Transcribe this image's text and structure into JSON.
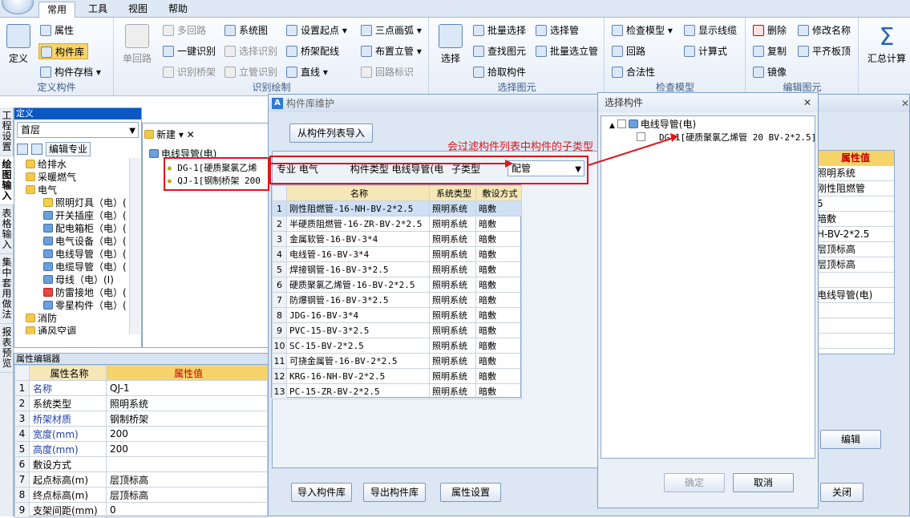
{
  "ribbon": {
    "tabs": [
      "常用",
      "工具",
      "视图",
      "帮助"
    ],
    "active_tab": "常用",
    "groups": {
      "define": {
        "label": "定义构件",
        "big_button": "定义",
        "items": [
          "属性",
          "构件库",
          "构件存档"
        ]
      },
      "draw": {
        "label": "识别绘制",
        "big_button": "单回路",
        "items": [
          "多回路",
          "一键识别",
          "识别桥架",
          "系统图",
          "选择识别",
          "立管识别",
          "设置起点",
          "桥架配线",
          "直线",
          "三点画弧",
          "布置立管",
          "回路标识"
        ]
      },
      "select": {
        "label": "选择图元",
        "big_button": "选择",
        "items": [
          "批量选择",
          "查找图元",
          "拾取构件",
          "选择管",
          "批量选立管"
        ]
      },
      "check": {
        "label": "检查模型",
        "items": [
          "检查模型",
          "回路",
          "合法性",
          "显示线缆",
          "计算式"
        ]
      },
      "edit": {
        "label": "编辑图元",
        "items": [
          "删除",
          "复制",
          "镜像",
          "修改名称",
          "平齐板顶"
        ]
      },
      "calc": {
        "big_button": "汇总计算"
      }
    }
  },
  "left_nav": {
    "tabs": [
      "工程设置",
      "绘图输入",
      "表格输入",
      "集中套用做法",
      "报表预览"
    ],
    "active": "绘图输入"
  },
  "define_panel": {
    "title": "定义",
    "floor": "首层",
    "edit_label": "编辑专业",
    "tree": [
      {
        "label": "给排水",
        "level": 1,
        "type": "folder"
      },
      {
        "label": "采暖燃气",
        "level": 1,
        "type": "folder"
      },
      {
        "label": "电气",
        "level": 1,
        "type": "folder"
      },
      {
        "label": "照明灯具（电）(",
        "level": 2,
        "type": "item"
      },
      {
        "label": "开关插座（电）(",
        "level": 2,
        "type": "item"
      },
      {
        "label": "配电箱柜（电）(",
        "level": 2,
        "type": "item"
      },
      {
        "label": "电气设备（电）(",
        "level": 2,
        "type": "item"
      },
      {
        "label": "电线导管（电）(",
        "level": 2,
        "type": "item"
      },
      {
        "label": "电缆导管（电）(",
        "level": 2,
        "type": "item"
      },
      {
        "label": "母线（电）(I)",
        "level": 2,
        "type": "item"
      },
      {
        "label": "防雷接地（电）(",
        "level": 2,
        "type": "item"
      },
      {
        "label": "零星构件（电）(",
        "level": 2,
        "type": "item"
      },
      {
        "label": "消防",
        "level": 1,
        "type": "folder"
      },
      {
        "label": "通风空调",
        "level": 1,
        "type": "folder"
      }
    ]
  },
  "component_list": {
    "new_label": "新建",
    "root": "电线导管(电)",
    "items": [
      "DG-1[硬质聚氯乙烯",
      "QJ-1[钢制桥架 200"
    ]
  },
  "property_editor": {
    "title": "属性编辑器",
    "col_name": "属性名称",
    "col_value": "属性值",
    "rows": [
      {
        "n": "1",
        "name": "名称",
        "value": "QJ-1"
      },
      {
        "n": "2",
        "name": "系统类型",
        "value": "照明系统"
      },
      {
        "n": "3",
        "name": "桥架材质",
        "value": "钢制桥架"
      },
      {
        "n": "4",
        "name": "宽度(mm)",
        "value": "200"
      },
      {
        "n": "5",
        "name": "高度(mm)",
        "value": "200"
      },
      {
        "n": "6",
        "name": "敷设方式",
        "value": ""
      },
      {
        "n": "7",
        "name": "起点标高(m)",
        "value": "层顶标高"
      },
      {
        "n": "8",
        "name": "终点标高(m)",
        "value": "层顶标高"
      },
      {
        "n": "9",
        "name": "支架间距(mm)",
        "value": "0"
      }
    ]
  },
  "library_dialog": {
    "title": "构件库维护",
    "import_from_list": "从构件列表导入",
    "filter": {
      "specialty_label": "专业",
      "specialty_value": "电气",
      "type_label": "构件类型",
      "type_value": "电线导管(电",
      "subtype_label": "子类型",
      "subtype_value": "配管"
    },
    "grid_headers": [
      "名称",
      "系统类型",
      "敷设方式"
    ],
    "rows": [
      {
        "n": "1",
        "name": "刚性阻燃管-16-NH-BV-2*2.5",
        "system": "照明系统",
        "lay": "暗敷"
      },
      {
        "n": "2",
        "name": "半硬质阻燃管-16-ZR-BV-2*2.5",
        "system": "照明系统",
        "lay": "暗敷"
      },
      {
        "n": "3",
        "name": "金属软管-16-BV-3*4",
        "system": "照明系统",
        "lay": "暗敷"
      },
      {
        "n": "4",
        "name": "电线管-16-BV-3*4",
        "system": "照明系统",
        "lay": "暗敷"
      },
      {
        "n": "5",
        "name": "焊接钢管-16-BV-3*2.5",
        "system": "照明系统",
        "lay": "暗敷"
      },
      {
        "n": "6",
        "name": "硬质聚氯乙烯管-16-BV-2*2.5",
        "system": "照明系统",
        "lay": "暗敷"
      },
      {
        "n": "7",
        "name": "防爆钢管-16-BV-3*2.5",
        "system": "照明系统",
        "lay": "暗敷"
      },
      {
        "n": "8",
        "name": "JDG-16-BV-3*4",
        "system": "照明系统",
        "lay": "暗敷"
      },
      {
        "n": "9",
        "name": "PVC-15-BV-3*2.5",
        "system": "照明系统",
        "lay": "暗敷"
      },
      {
        "n": "10",
        "name": "SC-15-BV-2*2.5",
        "system": "照明系统",
        "lay": "暗敷"
      },
      {
        "n": "11",
        "name": "可挠金属管-16-BV-2*2.5",
        "system": "照明系统",
        "lay": "暗敷"
      },
      {
        "n": "12",
        "name": "KRG-16-NH-BV-2*2.5",
        "system": "照明系统",
        "lay": "暗敷"
      },
      {
        "n": "13",
        "name": "PC-15-ZR-BV-2*2.5",
        "system": "照明系统",
        "lay": "暗敷"
      }
    ],
    "right_prop_header": "属性值",
    "right_prop_values": [
      "照明系统",
      "刚性阻燃管",
      "5",
      "暗敷",
      "H-BV-2*2.5",
      "层顶标高",
      "层顶标高",
      "",
      "电线导管(电)",
      "",
      "",
      ""
    ],
    "edit_button": "编辑",
    "import_button": "导入构件库",
    "export_button": "导出构件库",
    "props_button": "属性设置",
    "close_button": "关闭"
  },
  "select_dialog": {
    "title": "选择构件",
    "root": "电线导管(电)",
    "item": "DG-1[硬质聚氯乙烯管 20 BV-2*2.5]",
    "ok": "确定",
    "cancel": "取消"
  },
  "annotation": "会过滤构件列表中构件的子类型",
  "colors": {
    "annotation_red": "#e0151b",
    "title_blue": "#0a58c4",
    "header_gold": "#f7d46a"
  }
}
